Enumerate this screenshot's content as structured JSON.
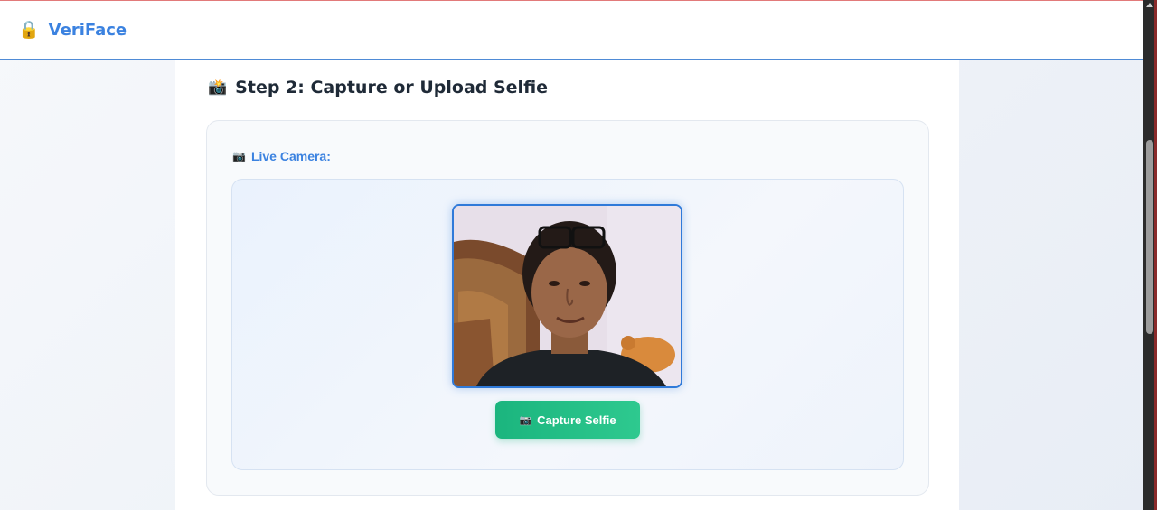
{
  "header": {
    "brand_icon": "lock-icon",
    "brand_icon_glyph": "🔒",
    "brand_name": "VeriFace"
  },
  "step": {
    "icon": "camera-icon",
    "icon_glyph": "📸",
    "title": "Step 2: Capture or Upload Selfie"
  },
  "camera": {
    "label_icon": "camera-icon",
    "label_icon_glyph": "📷",
    "label": "Live Camera:",
    "video_alt": "live camera feed",
    "capture_button": {
      "icon": "camera-icon",
      "icon_glyph": "📷",
      "label": "Capture Selfie"
    }
  },
  "colors": {
    "accent": "#3b82e0",
    "button": "#1bb57e",
    "video_border": "#2f7ad9"
  }
}
